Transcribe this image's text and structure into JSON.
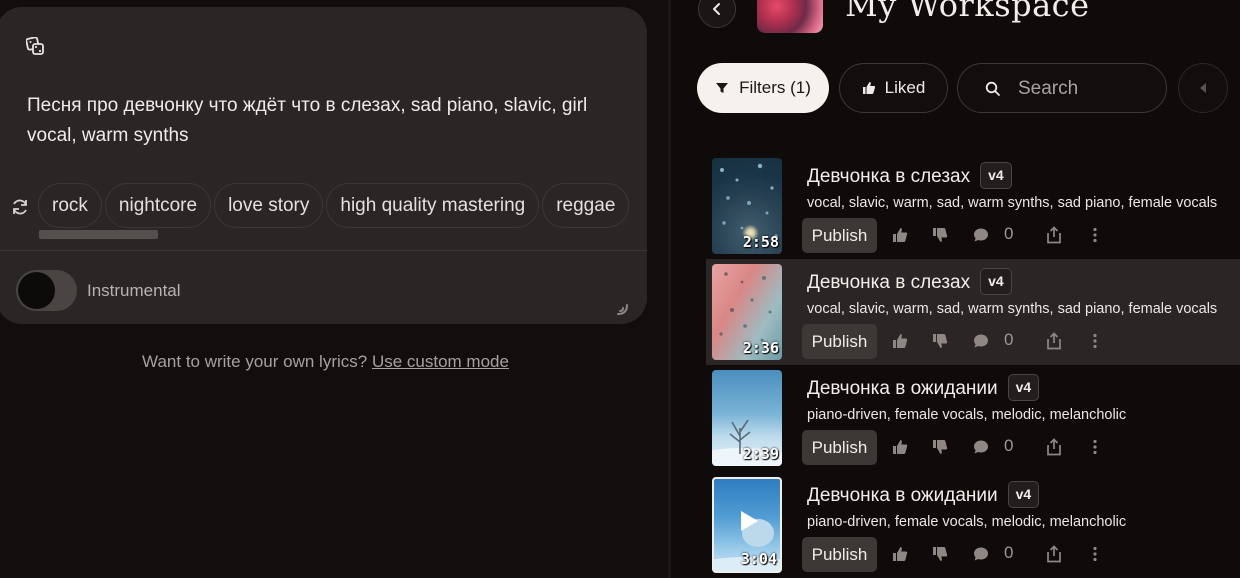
{
  "left": {
    "prompt": "Песня про девчонку что ждёт что в слезах, sad piano, slavic, girl vocal, warm synths",
    "tags": [
      "rock",
      "nightcore",
      "love story",
      "high quality mastering",
      "reggae"
    ],
    "instrumental_label": "Instrumental",
    "custom_prefix": "Want to write your own lyrics?",
    "custom_link": "Use custom mode"
  },
  "header": {
    "title": "My Workspace"
  },
  "toolbar": {
    "filters_label": "Filters (1)",
    "liked_label": "Liked",
    "search_placeholder": "Search"
  },
  "tracks": [
    {
      "title": "Девчонка в слезах",
      "version": "v4",
      "tags": "vocal, slavic, warm, sad, warm synths, sad piano, female vocals",
      "duration": "2:58",
      "publish": "Publish",
      "comments": "0"
    },
    {
      "title": "Девчонка в слезах",
      "version": "v4",
      "tags": "vocal, slavic, warm, sad, warm synths, sad piano, female vocals",
      "duration": "2:36",
      "publish": "Publish",
      "comments": "0"
    },
    {
      "title": "Девчонка в ожидании",
      "version": "v4",
      "tags": "piano-driven, female vocals, melodic, melancholic",
      "duration": "2:39",
      "publish": "Publish",
      "comments": "0"
    },
    {
      "title": "Девчонка в ожидании",
      "version": "v4",
      "tags": "piano-driven, female vocals, melodic, melancholic",
      "duration": "3:04",
      "publish": "Publish",
      "comments": "0"
    }
  ],
  "icons": [
    "dice-icon",
    "refresh-icon",
    "resize-icon",
    "back-arrow-icon",
    "filter-icon",
    "thumbs-up-icon",
    "search-icon",
    "chevron-left-icon",
    "thumbs-down-icon",
    "comment-icon",
    "share-icon",
    "more-icon",
    "play-icon"
  ],
  "colors": {
    "background": "#0f0b0b",
    "card": "#2a2625",
    "filters_active": "#f6f1ec",
    "publish_bg": "#3d3836"
  }
}
